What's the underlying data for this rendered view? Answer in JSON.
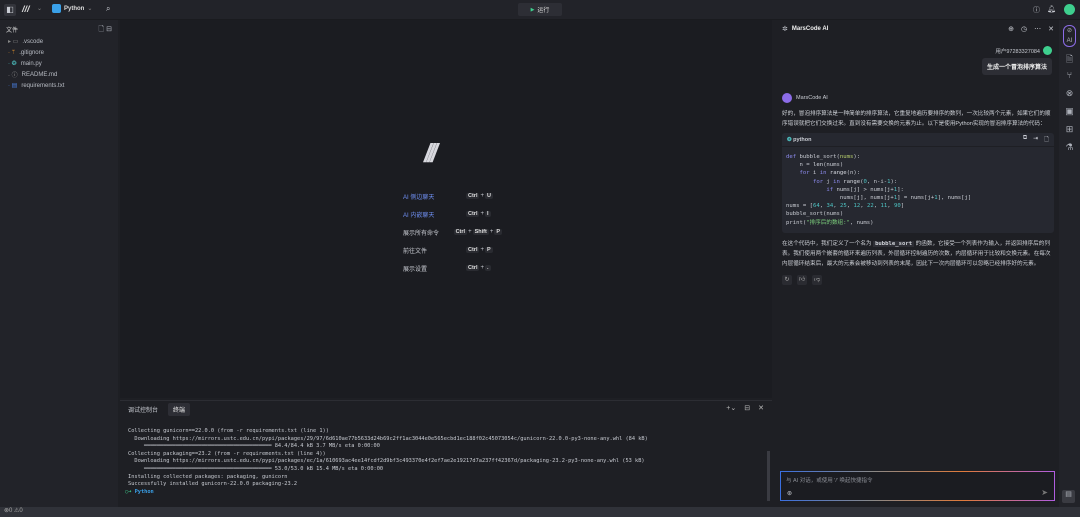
{
  "topbar": {
    "language": "Python",
    "run_label": "运行"
  },
  "sidebar": {
    "title": "文件",
    "files": [
      {
        "name": ".vscode",
        "icon": "folder-icon"
      },
      {
        "name": ".gitignore",
        "icon": "git-icon"
      },
      {
        "name": "main.py",
        "icon": "python-icon"
      },
      {
        "name": "README.md",
        "icon": "info-icon"
      },
      {
        "name": "requirements.txt",
        "icon": "text-file-icon"
      }
    ]
  },
  "editor": {
    "shortcuts": [
      {
        "label": "AI 侧边聊天",
        "keys": [
          "Ctrl",
          "+",
          "U"
        ]
      },
      {
        "label": "AI 内嵌聊天",
        "keys": [
          "Ctrl",
          "+",
          "I"
        ]
      },
      {
        "label": "展示所有命令",
        "keys": [
          "Ctrl",
          "+",
          "Shift",
          "+",
          "P"
        ]
      },
      {
        "label": "前往文件",
        "keys": [
          "Ctrl",
          "+",
          "P"
        ]
      },
      {
        "label": "展示设置",
        "keys": [
          "Ctrl",
          "+",
          "."
        ]
      }
    ]
  },
  "terminal": {
    "tabs": [
      "调试控制台",
      "终端"
    ],
    "active_tab": "终端",
    "lines": [
      "Collecting gunicorn==22.0.0 (from -r requirements.txt (line 1))",
      "  Downloading https://mirrors.ustc.edu.cn/pypi/packages/29/97/6d610ae77b5633d24b69c2ff1ac3044e0e565ecbd1ec188f02c45073054c/gunicorn-22.0.0-py3-none-any.whl (84 kB)",
      "     ━━━━━━━━━━━━━━━━━━━━━━━━━━━━━━━━━━━━━━━━ 84.4/84.4 kB 3.7 MB/s eta 0:00:00",
      "Collecting packaging==23.2 (from -r requirements.txt (line 4))",
      "  Downloading https://mirrors.ustc.edu.cn/pypi/packages/ec/1a/610693ac4ee14fcdf2d9bf3c493370e4f2ef7ae2e19217d7a237ff42367d/packaging-23.2-py3-none-any.whl (53 kB)",
      "     ━━━━━━━━━━━━━━━━━━━━━━━━━━━━━━━━━━━━━━━━ 53.0/53.0 kB 15.4 MB/s eta 0:00:00",
      "Installing collected packages: packaging, gunicorn",
      "Successfully installed gunicorn-22.0.0 packaging-23.2"
    ],
    "prompt": "Python"
  },
  "chat": {
    "title": "MarsCode AI",
    "user_name": "用户972833270​84",
    "user_message": "生成一个冒泡排序算法",
    "ai_name": "MarsCode AI",
    "intro": "好的，冒泡排序算法是一种简单的排序算法，它重复地遍历要排序的数列，一次比较两个元素，如果它们的顺序错误就把它们交换过来。直到没有需要交换的元素为止。以下是使用Python实现的冒泡排序算法的代码：",
    "code_lang": "python",
    "outro_pre": "在这个代码中，我们定义了一个名为 ",
    "outro_code": "bubble_sort",
    "outro_post": " 的函数，它接受一个列表作为输入，并返回排序后的列表。我们使用两个嵌套的循环来遍历列表，外层循环控制遍历的次数，内层循环用于比较和交换元素。在每次内层循环结束后，最大的元素会被移动到列表的末尾，因此下一次内层循环可以忽略已经排序好的元素。",
    "input_placeholder": "与 AI 对话，或使用 '/' 唤起快捷指令"
  }
}
